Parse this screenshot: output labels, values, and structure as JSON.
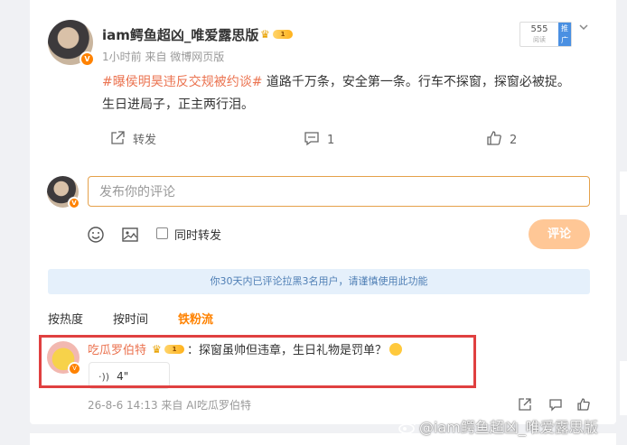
{
  "post": {
    "author": "iam鳄鱼超凶_唯爱露思版",
    "vip_level": "1",
    "time": "1小时前",
    "source": "来自 微博网页版",
    "hashtag": "#曝侯明昊违反交规被约谈#",
    "body": " 道路千万条，安全第一条。行车不探窗，探窗必被捉。生日进局子，正主两行泪。",
    "views_count": "555",
    "views_label": "阅读",
    "promote_label": "推广",
    "forward_label": "转发",
    "comment_count": "1",
    "like_count": "2"
  },
  "composer": {
    "placeholder": "发布你的评论",
    "repost_label": "同时转发",
    "submit_label": "评论"
  },
  "notice": "你30天内已评论拉黑3名用户，请谨慎使用此功能",
  "tabs": [
    "按热度",
    "按时间",
    "铁粉流"
  ],
  "comment": {
    "author": "吃瓜罗伯特",
    "vip_level": "1",
    "text": "：探窗虽帅但违章，生日礼物是罚单？",
    "voice_duration": "4\"",
    "meta": "26-8-6 14:13 来自 AI吃瓜罗伯特"
  },
  "watermark": "@iam鳄鱼超凶_唯爱露思版",
  "colors": {
    "accent": "#ff8200",
    "hashtag": "#eb7350",
    "highlight": "#e04040",
    "submit": "#ffc796",
    "notice_bg": "#e5f0fb"
  }
}
